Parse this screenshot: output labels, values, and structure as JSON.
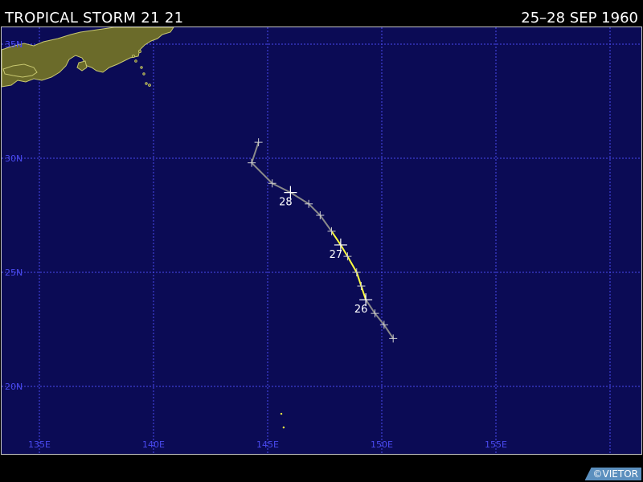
{
  "title": {
    "storm_name": "TROPICAL STORM 21 21",
    "date_range": "25–28 SEP 1960"
  },
  "credit": "©VIETOR",
  "colors": {
    "ocean": "#0b0b55",
    "grid": "#4a4af0",
    "land": "#6b6b2a",
    "coast": "#c8c870",
    "track_weak": "#8a8a8a",
    "track_strong": "#ffff40",
    "marker": "#d0d0d0",
    "label": "#ffffff"
  },
  "map": {
    "lat_labels": [
      "35N",
      "30N",
      "25N",
      "20N"
    ],
    "lon_labels": [
      "135E",
      "140E",
      "145E",
      "150E",
      "155E"
    ]
  },
  "track": {
    "points": [
      {
        "lat": 22.1,
        "lon": 150.5,
        "stage": "weak"
      },
      {
        "lat": 22.7,
        "lon": 150.1,
        "stage": "weak"
      },
      {
        "lat": 23.2,
        "lon": 149.7,
        "stage": "weak"
      },
      {
        "lat": 23.8,
        "lon": 149.3,
        "stage": "strong"
      },
      {
        "lat": 24.4,
        "lon": 149.1,
        "stage": "strong"
      },
      {
        "lat": 25.0,
        "lon": 148.9,
        "stage": "strong"
      },
      {
        "lat": 25.7,
        "lon": 148.5,
        "stage": "strong"
      },
      {
        "lat": 26.2,
        "lon": 148.2,
        "stage": "strong"
      },
      {
        "lat": 26.8,
        "lon": 147.8,
        "stage": "weak"
      },
      {
        "lat": 27.5,
        "lon": 147.3,
        "stage": "weak"
      },
      {
        "lat": 28.0,
        "lon": 146.8,
        "stage": "weak"
      },
      {
        "lat": 28.5,
        "lon": 146.0,
        "stage": "weak"
      },
      {
        "lat": 28.9,
        "lon": 145.2,
        "stage": "weak"
      },
      {
        "lat": 29.8,
        "lon": 144.3,
        "stage": "weak"
      },
      {
        "lat": 30.7,
        "lon": 144.6,
        "stage": "weak"
      }
    ],
    "day_labels": [
      {
        "text": "26",
        "lat": 23.8,
        "lon": 149.3
      },
      {
        "text": "27",
        "lat": 26.2,
        "lon": 148.2
      },
      {
        "text": "28",
        "lat": 28.5,
        "lon": 146.0
      }
    ]
  },
  "islands": [
    {
      "lat": 18.8,
      "lon": 145.6
    },
    {
      "lat": 18.2,
      "lon": 145.7
    }
  ]
}
